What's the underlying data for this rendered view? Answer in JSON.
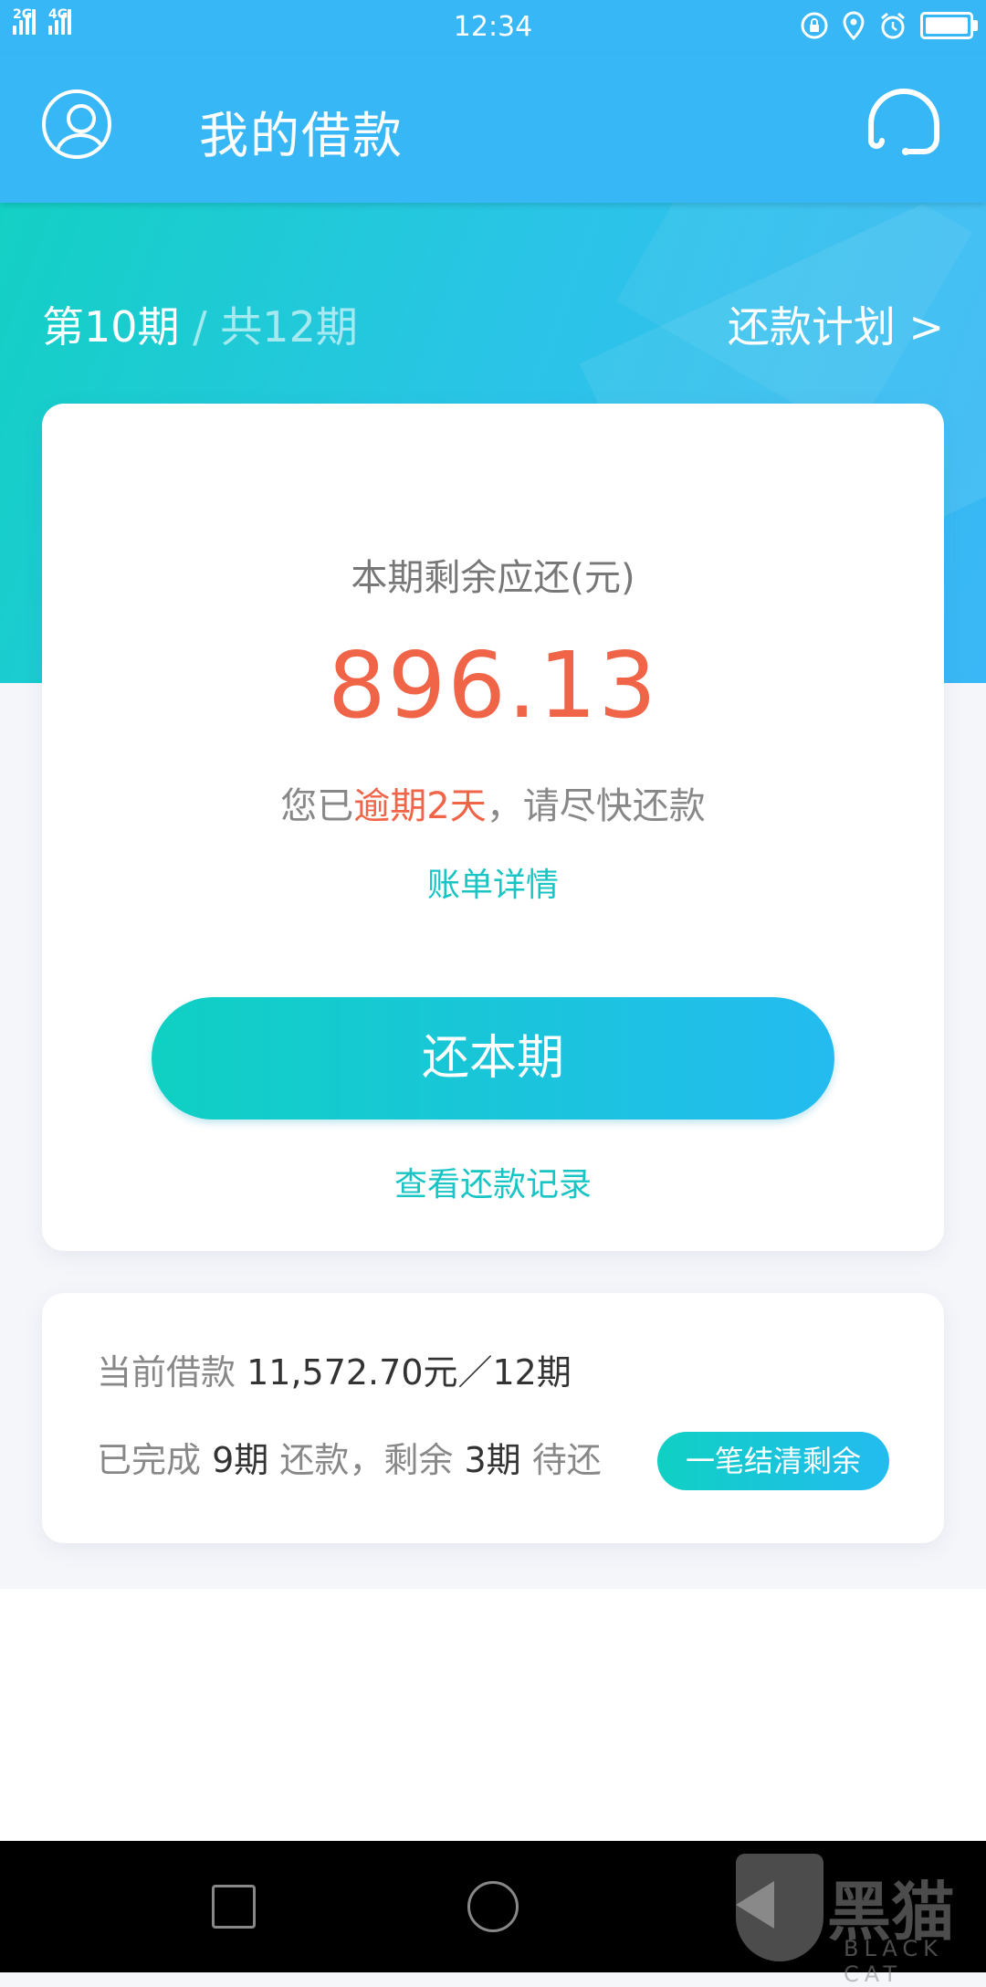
{
  "status_bar": {
    "time": "12:34",
    "signal1_label": "2G",
    "signal2_label": "4G"
  },
  "app_bar": {
    "title": "我的借款",
    "avatar_icon": "user-avatar-icon",
    "service_icon": "headset-icon"
  },
  "period": {
    "current": "第10期",
    "separator": " / ",
    "total": "共12期",
    "plan_link": "还款计划 >"
  },
  "due": {
    "label": "本期剩余应还(元)",
    "amount": "896.13",
    "overdue_prefix": "您已",
    "overdue_days": "逾期2天",
    "overdue_suffix": "，请尽快还款",
    "detail_link": "账单详情",
    "pay_button": "还本期",
    "records_link": "查看还款记录"
  },
  "loan": {
    "current_label": "当前借款 ",
    "current_value": "11,572.70元／12期",
    "done_label": "已完成 ",
    "done_value": "9期",
    "done_mid": " 还款，剩余 ",
    "remaining_value": "3期",
    "remaining_suffix": " 待还",
    "settle_button": "一笔结清剩余"
  },
  "watermark": {
    "text": "黑猫",
    "sub": "BLACK CAT"
  },
  "colors": {
    "primary": "#38b7f6",
    "accent_teal": "#19c5c4",
    "alert_red": "#f06448"
  }
}
